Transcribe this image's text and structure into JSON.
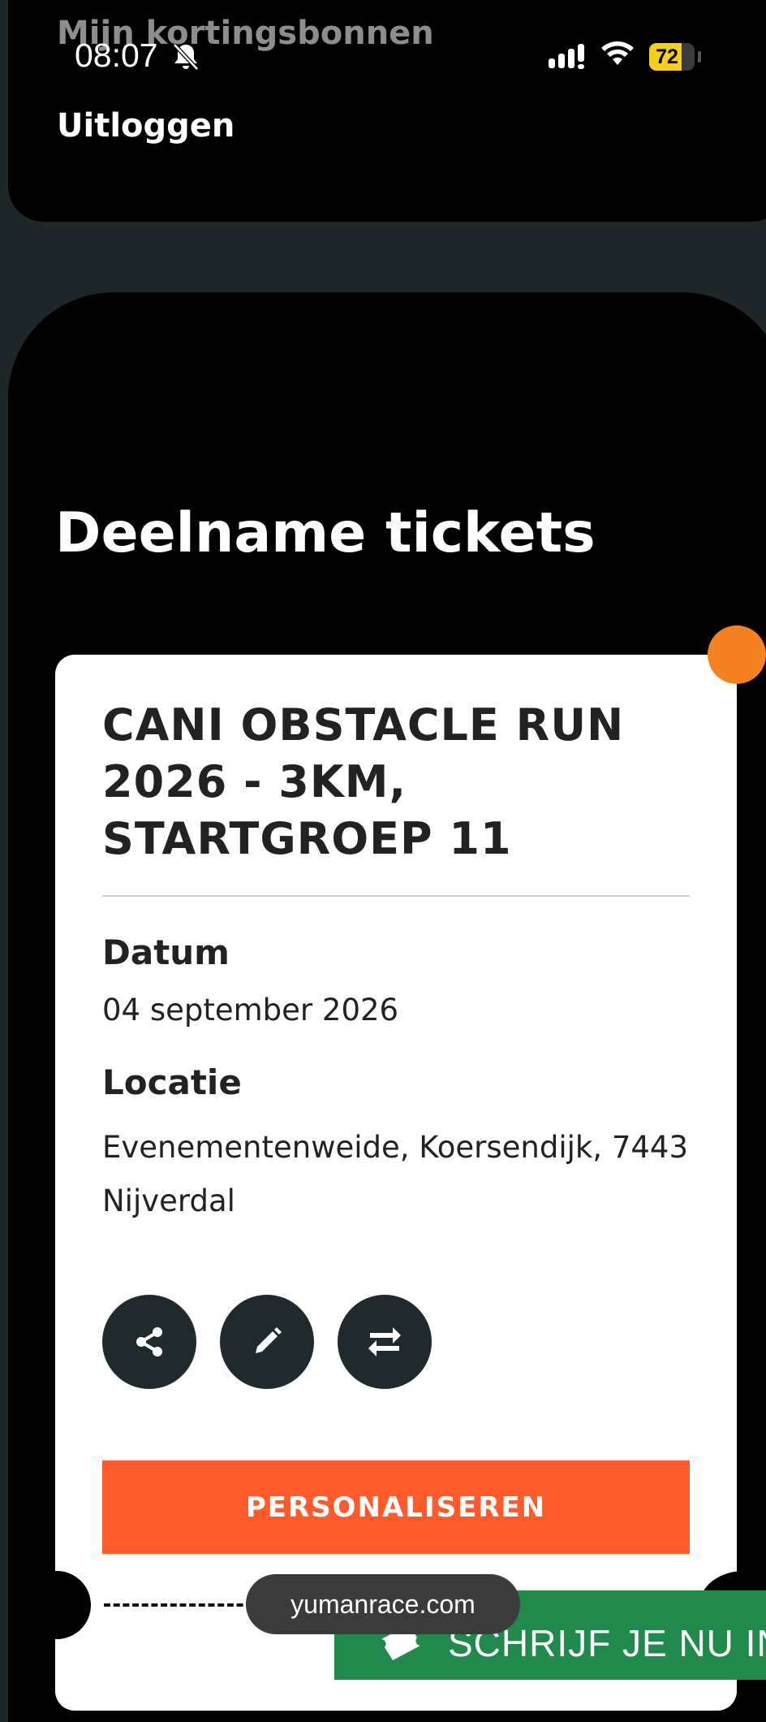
{
  "status_bar": {
    "time": "08:07",
    "battery": "72",
    "icons": [
      "bell-off-icon",
      "signal-icon",
      "wifi-icon",
      "battery-icon"
    ]
  },
  "menu": {
    "discounts": "Mijn kortingsbonnen",
    "logout": "Uitloggen"
  },
  "section": {
    "title": "Deelname tickets"
  },
  "ticket": {
    "title": "CANI OBSTACLE RUN 2026 - 3KM, STARTGROEP 11",
    "date_label": "Datum",
    "date_value": "04 september 2026",
    "location_label": "Locatie",
    "location_value": "Evenementenweide, Koersendijk, 7443 Nijverdal",
    "actions": [
      "share-icon",
      "edit-icon",
      "transfer-icon"
    ],
    "personalize_label": "PERSONALISEREN"
  },
  "browser": {
    "url": "yumanrace.com"
  },
  "banner": {
    "label": "SCHRIJF JE NU IN!"
  },
  "colors": {
    "accent_orange": "#fd5b2c",
    "dot_orange": "#f58220",
    "banner_green": "#1f8a4c",
    "dark_button": "#1e2a2d"
  }
}
